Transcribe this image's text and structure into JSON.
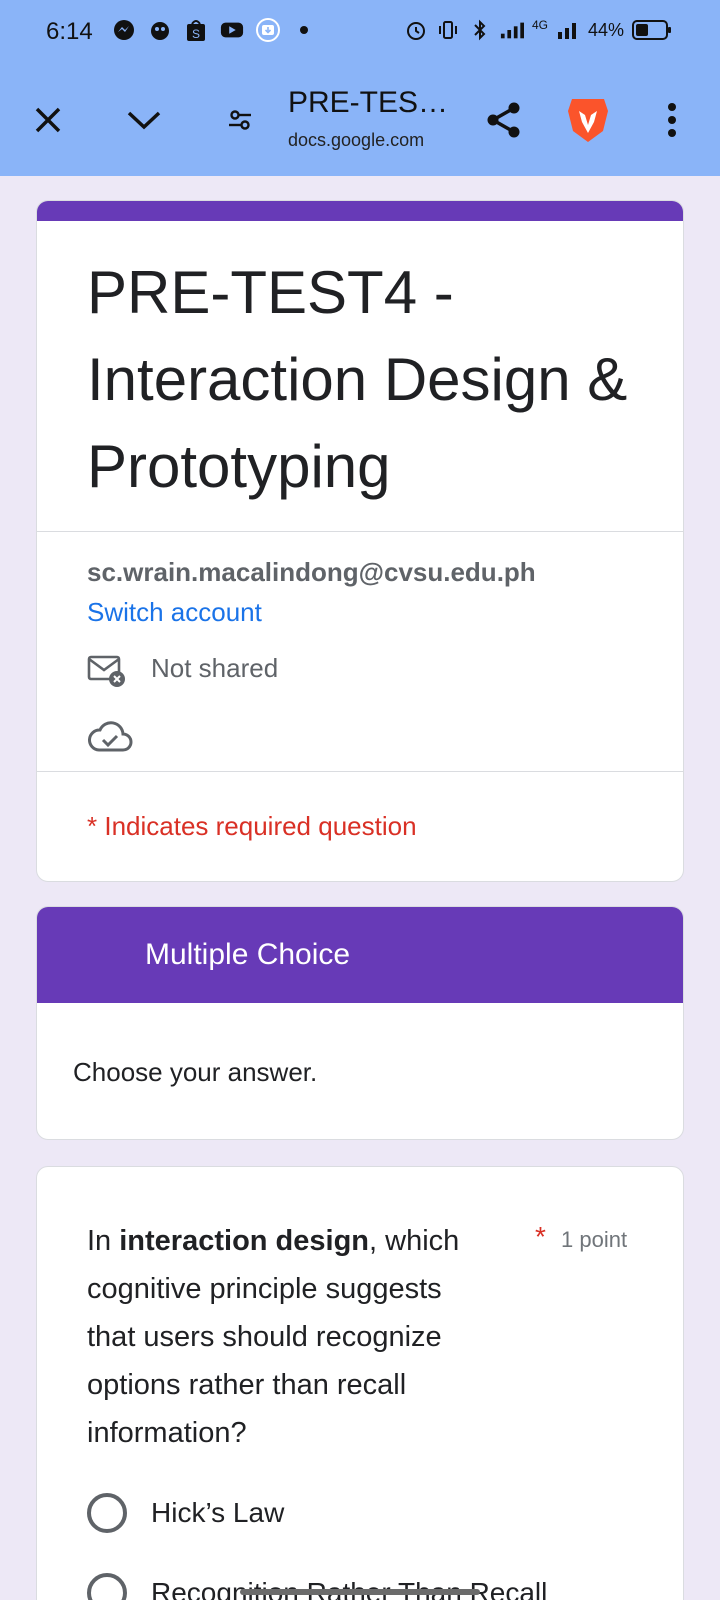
{
  "status_bar": {
    "time": "6:14",
    "network": "4G",
    "battery_percent": "44%",
    "battery_level": 0.44,
    "app_icons": [
      "messenger-icon",
      "privacy-icon",
      "shopee-icon",
      "youtube-icon",
      "download-icon"
    ]
  },
  "browser": {
    "tab_title": "PRE-TES…",
    "url": "docs.google.com"
  },
  "form": {
    "title": "PRE-TEST4 - Interaction Design & Prototyping",
    "email": "sc.wrain.macalindong@cvsu.edu.ph",
    "switch_account": "Switch account",
    "not_shared": "Not shared",
    "required_note": "* Indicates required question"
  },
  "section": {
    "title": "Multiple Choice",
    "description": "Choose your answer."
  },
  "question": {
    "text_prefix": "In ",
    "text_bold": "interaction design",
    "text_suffix": ", which cognitive principle suggests that users should recognize options rather than recall information?",
    "required_marker": "*",
    "points": "1 point",
    "options": [
      {
        "label": "Hick’s Law"
      },
      {
        "label": "Recognition Rather Than Recall"
      }
    ]
  },
  "colors": {
    "browser_bar": "#8ab4f8",
    "form_accent": "#673ab7",
    "link": "#1a73e8",
    "required": "#d93025",
    "page_bg": "#ede8f6"
  }
}
